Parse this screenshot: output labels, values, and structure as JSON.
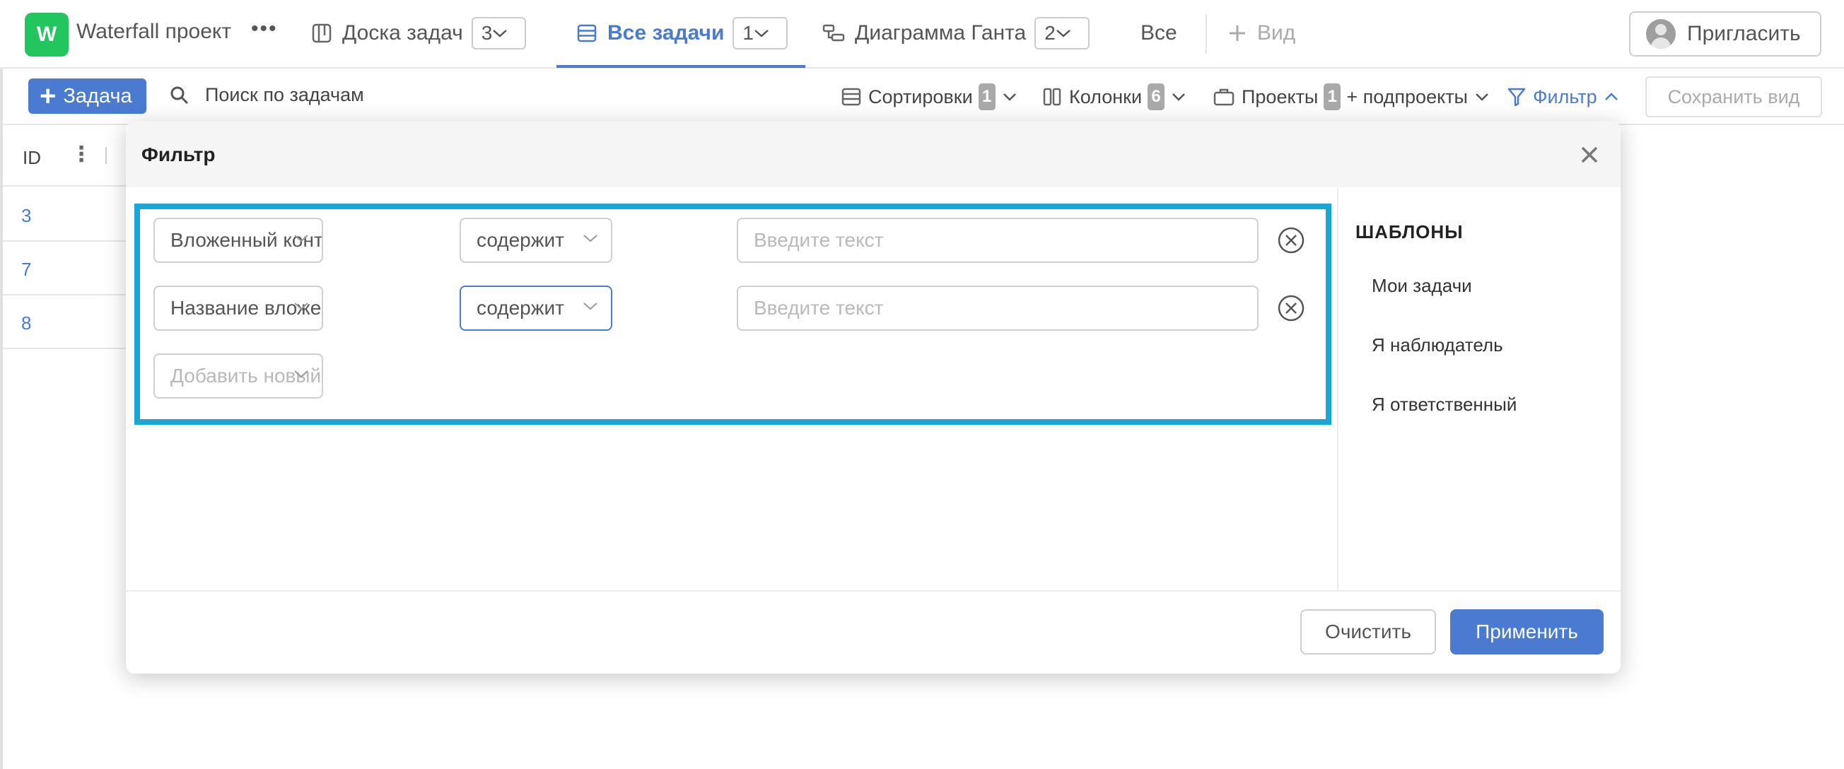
{
  "header": {
    "logo_letter": "W",
    "project_title": "Waterfall проект",
    "more_symbol": "•••",
    "tabs": [
      {
        "label": "Доска задач",
        "count": "3",
        "icon": "board-icon"
      },
      {
        "label": "Все задачи",
        "count": "1",
        "icon": "list-icon",
        "active": true
      },
      {
        "label": "Диаграмма Ганта",
        "count": "2",
        "icon": "gantt-icon"
      }
    ],
    "all_label": "Все",
    "add_view_label": "Вид",
    "invite_label": "Пригласить"
  },
  "toolbar": {
    "add_task_label": "Задача",
    "search_placeholder": "Поиск по задачам",
    "sort_label": "Сортировки",
    "sort_count": "1",
    "columns_label": "Колонки",
    "columns_count": "6",
    "projects_label": "Проекты",
    "projects_count": "1",
    "subprojects_label": "+ подпроекты",
    "filter_label": "Фильтр",
    "save_view_label": "Сохранить вид"
  },
  "table": {
    "id_header": "ID",
    "rows": [
      "3",
      "7",
      "8"
    ]
  },
  "filter_modal": {
    "title": "Фильтр",
    "rows": [
      {
        "field": "Вложенный контент",
        "operator": "содержит",
        "value_placeholder": "Введите текст"
      },
      {
        "field": "Название вложенног...",
        "operator": "содержит",
        "value_placeholder": "Введите текст"
      }
    ],
    "add_filter_placeholder": "Добавить новый фил...",
    "templates_title": "ШАБЛОНЫ",
    "templates": [
      "Мои задачи",
      "Я наблюдатель",
      "Я ответственный"
    ],
    "clear_label": "Очистить",
    "apply_label": "Применить"
  },
  "colors": {
    "accent": "#4a7bd0",
    "logo_green": "#22c55e",
    "highlight_border": "#1aa7d6"
  }
}
